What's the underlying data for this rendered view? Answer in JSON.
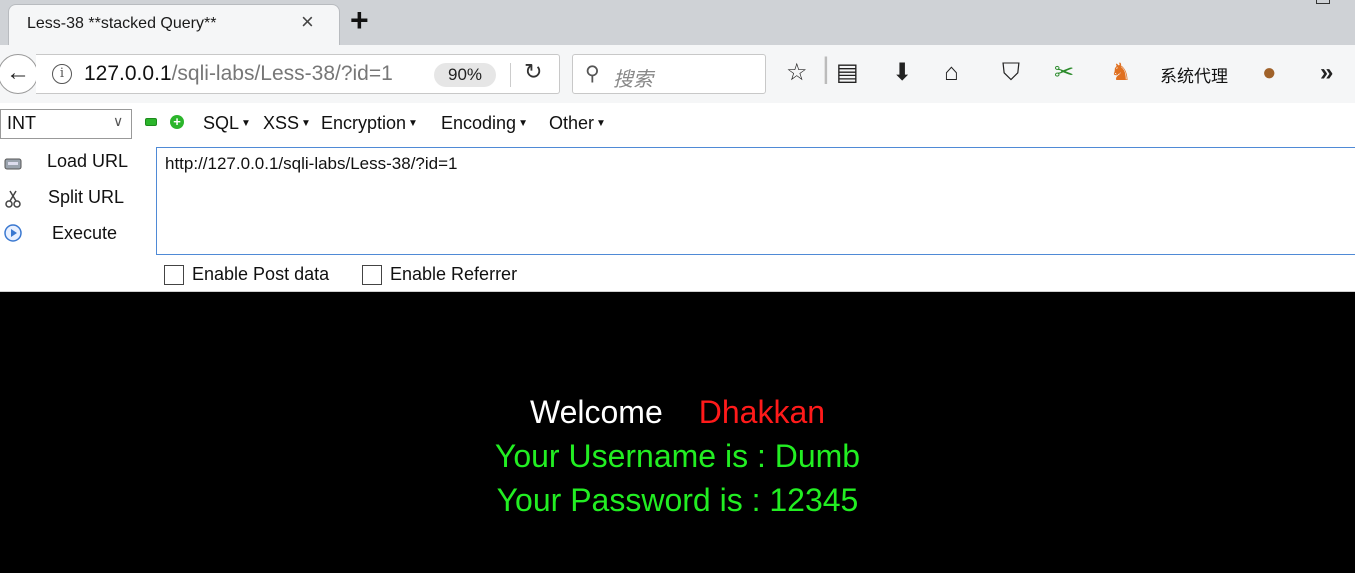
{
  "tab": {
    "title": "Less-38 **stacked Query**",
    "close_icon": "×",
    "newtab_icon": "+"
  },
  "navbar": {
    "url_host": "127.0.0.1",
    "url_path": "/sqli-labs/Less-38/?id=1",
    "zoom": "90%",
    "search_placeholder": "搜索",
    "proxy_label": "系统代理"
  },
  "hackbar": {
    "type_select": "INT",
    "menus": [
      "SQL",
      "XSS",
      "Encryption",
      "Encoding",
      "Other"
    ],
    "load_url": "Load URL",
    "split_url": "Split URL",
    "execute": "Execute",
    "url_value": "http://127.0.0.1/sqli-labs/Less-38/?id=1",
    "enable_post": "Enable Post data",
    "enable_referrer": "Enable Referrer"
  },
  "page": {
    "welcome": "Welcome",
    "name": "Dhakkan",
    "username_line": "Your Username is : Dumb",
    "password_line": "Your Password is : 12345"
  },
  "colors": {
    "welcome": "#ffffff",
    "name": "#ff1a1a",
    "result": "#22ee22",
    "background": "#000000"
  }
}
